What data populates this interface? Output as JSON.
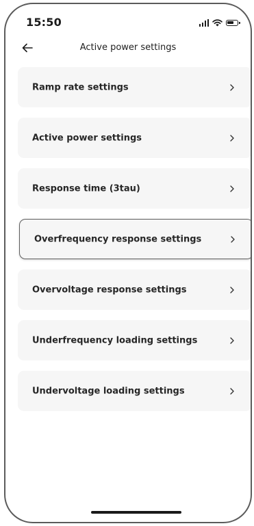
{
  "status_bar": {
    "time": "15:50",
    "icons": [
      "signal-icon",
      "wifi-icon",
      "battery-icon"
    ]
  },
  "nav": {
    "back_icon": "arrow-left-icon",
    "title": "Active power settings"
  },
  "menu": {
    "items": [
      {
        "label": "Ramp rate settings",
        "chevron": ">",
        "selected": false
      },
      {
        "label": "Active power settings",
        "chevron": ">",
        "selected": false
      },
      {
        "label": "Response time (3tau)",
        "chevron": ">",
        "selected": false
      },
      {
        "label": "Overfrequency response settings",
        "chevron": ">",
        "selected": true
      },
      {
        "label": "Overvoltage response settings",
        "chevron": ">",
        "selected": false
      },
      {
        "label": "Underfrequency loading settings",
        "chevron": ">",
        "selected": false
      },
      {
        "label": "Undervoltage loading settings",
        "chevron": ">",
        "selected": false
      }
    ]
  },
  "colors": {
    "card_background": "#f6f6f6",
    "text": "#262626",
    "selected_border": "#5f5f5f"
  }
}
